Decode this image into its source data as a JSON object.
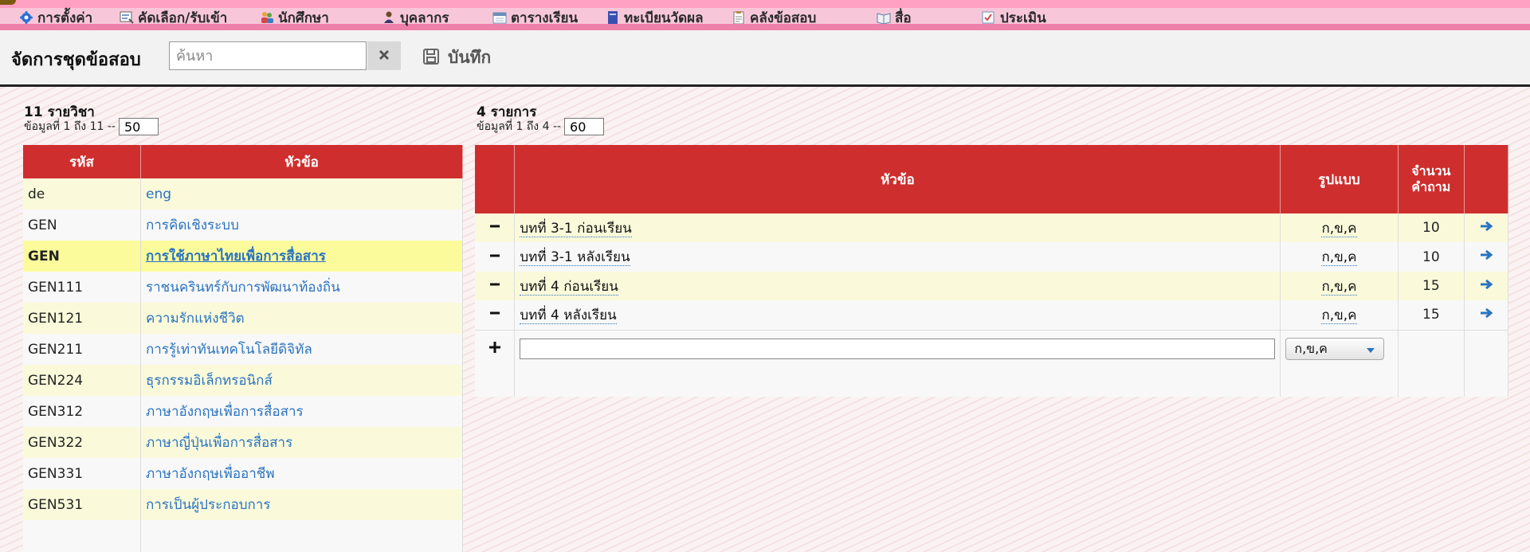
{
  "menu": [
    {
      "label": "การตั้งค่า",
      "icon": "gear-icon"
    },
    {
      "label": "คัดเลือก/รับเข้า",
      "icon": "select-icon"
    },
    {
      "label": "นักศึกษา",
      "icon": "students-icon"
    },
    {
      "label": "บุคลากร",
      "icon": "staff-icon"
    },
    {
      "label": "ตารางเรียน",
      "icon": "timetable-icon"
    },
    {
      "label": "ทะเบียนวัดผล",
      "icon": "registry-icon"
    },
    {
      "label": "คลังข้อสอบ",
      "icon": "exam-bank-icon"
    },
    {
      "label": "สื่อ",
      "icon": "media-icon"
    },
    {
      "label": "ประเมิน",
      "icon": "evaluate-icon"
    }
  ],
  "header": {
    "title": "จัดการชุดข้อสอบ",
    "search_placeholder": "ค้นหา",
    "save_label": "บันทึก"
  },
  "subjects": {
    "count_label": "11 รายวิชา",
    "range_prefix": "ข้อมูลที่ 1 ถึง 11 --",
    "page_size": "50",
    "columns": [
      "รหัส",
      "หัวข้อ"
    ],
    "rows": [
      {
        "code": "de",
        "title": "eng"
      },
      {
        "code": "GEN",
        "title": "การคิดเชิงระบบ"
      },
      {
        "code": "GEN",
        "title": "การใช้ภาษาไทยเพื่อการสื่อสาร",
        "selected": true
      },
      {
        "code": "GEN111",
        "title": "ราชนครินทร์กับการพัฒนาท้องถิ่น"
      },
      {
        "code": "GEN121",
        "title": "ความรักแห่งชีวิต"
      },
      {
        "code": "GEN211",
        "title": "การรู้เท่าทันเทคโนโลยีดิจิทัล"
      },
      {
        "code": "GEN224",
        "title": "ธุรกรรมอิเล็กทรอนิกส์"
      },
      {
        "code": "GEN312",
        "title": "ภาษาอังกฤษเพื่อการสื่อสาร"
      },
      {
        "code": "GEN322",
        "title": "ภาษาญี่ปุ่นเพื่อการสื่อสาร"
      },
      {
        "code": "GEN331",
        "title": "ภาษาอังกฤษเพื่ออาชีพ"
      },
      {
        "code": "GEN531",
        "title": "การเป็นผู้ประกอบการ"
      }
    ]
  },
  "exam_sets": {
    "count_label": "4 รายการ",
    "range_prefix": "ข้อมูลที่ 1 ถึง 4 --",
    "page_size": "60",
    "columns": {
      "title": "หัวข้อ",
      "format": "รูปแบบ",
      "count": "จำนวนคำถาม"
    },
    "rows": [
      {
        "title": "บทที่ 3-1 ก่อนเรียน",
        "format": "ก,ข,ค",
        "count": "10"
      },
      {
        "title": "บทที่ 3-1 หลังเรียน",
        "format": "ก,ข,ค",
        "count": "10"
      },
      {
        "title": "บทที่ 4 ก่อนเรียน",
        "format": "ก,ข,ค",
        "count": "15"
      },
      {
        "title": "บทที่ 4 หลังเรียน",
        "format": "ก,ข,ค",
        "count": "15"
      }
    ],
    "new_row": {
      "format_selected": "ก,ข,ค"
    }
  },
  "colors": {
    "header_red": "#cf2e2e",
    "link_blue": "#2a73c0",
    "row_yellow": "#fafadb",
    "row_selected": "#fbfb9c"
  }
}
